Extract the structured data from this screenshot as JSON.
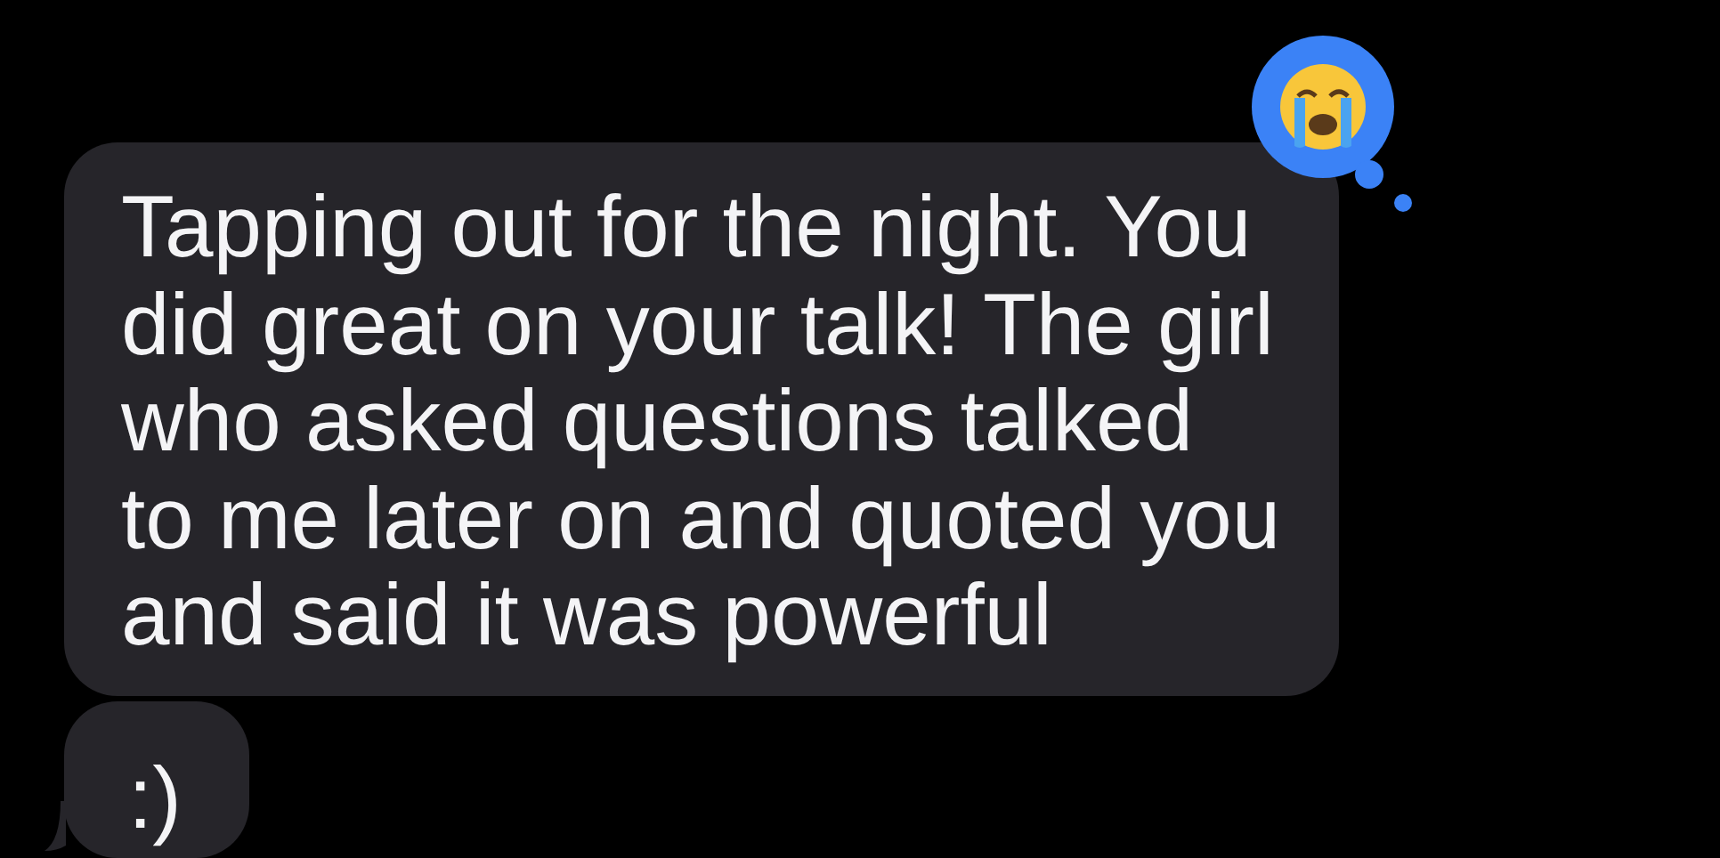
{
  "messages": [
    {
      "lines": [
        "Tapping out for the night. You",
        "did great on your talk! The girl",
        "who asked questions talked",
        "to me later on and quoted you",
        "and said it was powerful"
      ],
      "reaction": {
        "mine": true
      }
    },
    {
      "lines": [
        ":)"
      ]
    }
  ]
}
